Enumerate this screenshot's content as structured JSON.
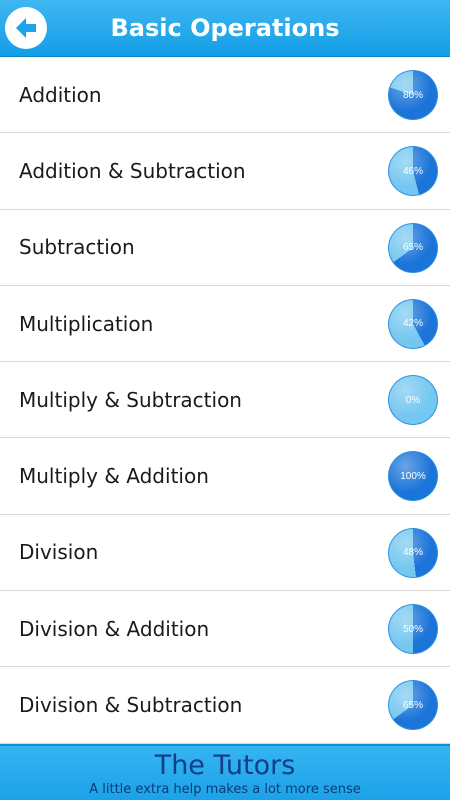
{
  "header": {
    "title": "Basic Operations",
    "back_icon": "arrow-left-icon"
  },
  "operations": [
    {
      "label": "Addition",
      "progress": 80,
      "progress_label": "80%"
    },
    {
      "label": "Addition & Subtraction",
      "progress": 46,
      "progress_label": "46%"
    },
    {
      "label": "Subtraction",
      "progress": 65,
      "progress_label": "65%"
    },
    {
      "label": "Multiplication",
      "progress": 42,
      "progress_label": "42%"
    },
    {
      "label": "Multiply & Subtraction",
      "progress": 0,
      "progress_label": "0%"
    },
    {
      "label": "Multiply & Addition",
      "progress": 100,
      "progress_label": "100%"
    },
    {
      "label": "Division",
      "progress": 48,
      "progress_label": "48%"
    },
    {
      "label": "Division & Addition",
      "progress": 50,
      "progress_label": "50%"
    },
    {
      "label": "Division & Subtraction",
      "progress": 65,
      "progress_label": "65%"
    }
  ],
  "footer": {
    "brand": "The Tutors",
    "tagline": "A little extra help makes a lot more sense"
  },
  "colors": {
    "header": "#1da5ea",
    "gauge_fill": "#1b74d8",
    "gauge_empty": "#74c7f0",
    "brand_text": "#123f86"
  }
}
